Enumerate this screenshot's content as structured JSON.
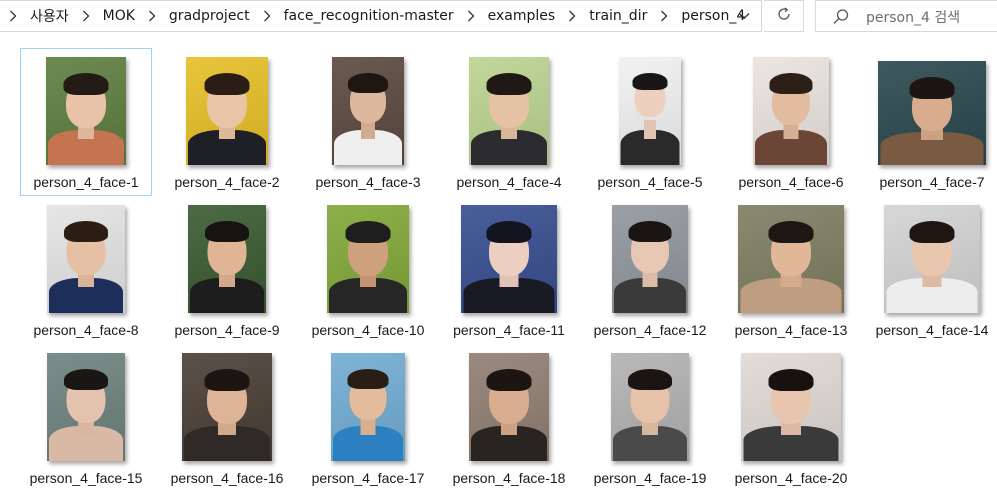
{
  "address_bar": {
    "breadcrumbs": [
      "사용자",
      "MOK",
      "gradproject",
      "face_recognition-master",
      "examples",
      "train_dir",
      "person_4"
    ]
  },
  "search": {
    "placeholder": "person_4 검색"
  },
  "files": [
    {
      "name": "person_4_face-1",
      "bg": "#6d8a52",
      "skin": "#e8c3a8",
      "hair": "#241b16",
      "cloth": "#c4744e",
      "selected": true
    },
    {
      "name": "person_4_face-2",
      "bg": "#e8c53a",
      "skin": "#e9c4a6",
      "hair": "#2a1d16",
      "cloth": "#1f1f26",
      "selected": false
    },
    {
      "name": "person_4_face-3",
      "bg": "#6a5a52",
      "skin": "#deb89c",
      "hair": "#1d1613",
      "cloth": "#efefef",
      "selected": false
    },
    {
      "name": "person_4_face-4",
      "bg": "#c2d89a",
      "skin": "#e6c2a5",
      "hair": "#201814",
      "cloth": "#2b2b30",
      "selected": false
    },
    {
      "name": "person_4_face-5",
      "bg": "#f2f2f2",
      "skin": "#ecd0bd",
      "hair": "#1a1616",
      "cloth": "#2a2a2a",
      "selected": false
    },
    {
      "name": "person_4_face-6",
      "bg": "#ece6e2",
      "skin": "#e3bb9f",
      "hair": "#2b1f18",
      "cloth": "#6b4637",
      "selected": false
    },
    {
      "name": "person_4_face-7",
      "bg": "#3e5a5e",
      "skin": "#d8ad8e",
      "hair": "#1d1512",
      "cloth": "#7a5a40",
      "selected": false
    },
    {
      "name": "person_4_face-8",
      "bg": "#e6e6e6",
      "skin": "#e5c0a4",
      "hair": "#2b1c14",
      "cloth": "#1e2e5a",
      "selected": false
    },
    {
      "name": "person_4_face-9",
      "bg": "#4c6a44",
      "skin": "#e0b596",
      "hair": "#181313",
      "cloth": "#1d1d1d",
      "selected": false
    },
    {
      "name": "person_4_face-10",
      "bg": "#8db04a",
      "skin": "#cfa07e",
      "hair": "#1e1e1e",
      "cloth": "#262626",
      "selected": false
    },
    {
      "name": "person_4_face-11",
      "bg": "#4a5f9a",
      "skin": "#eccfc0",
      "hair": "#141420",
      "cloth": "#1a1a24",
      "selected": false
    },
    {
      "name": "person_4_face-12",
      "bg": "#9aa0a6",
      "skin": "#e7c8b4",
      "hair": "#1a1412",
      "cloth": "#3a3a3a",
      "selected": false
    },
    {
      "name": "person_4_face-13",
      "bg": "#8a8a70",
      "skin": "#e1b79a",
      "hair": "#1d1613",
      "cloth": "#bf9d80",
      "selected": false
    },
    {
      "name": "person_4_face-14",
      "bg": "#d7d7d7",
      "skin": "#e8c7ae",
      "hair": "#1f1612",
      "cloth": "#ededed",
      "selected": false
    },
    {
      "name": "person_4_face-15",
      "bg": "#7b8e8a",
      "skin": "#e3c3ad",
      "hair": "#1a1613",
      "cloth": "#d9b8a6",
      "selected": false
    },
    {
      "name": "person_4_face-16",
      "bg": "#5b5148",
      "skin": "#ddb496",
      "hair": "#1c1512",
      "cloth": "#2f2a26",
      "selected": false
    },
    {
      "name": "person_4_face-17",
      "bg": "#7fb4d8",
      "skin": "#e4bc9c",
      "hair": "#2a1d15",
      "cloth": "#2c7fc0",
      "selected": false
    },
    {
      "name": "person_4_face-18",
      "bg": "#9a8a80",
      "skin": "#d8ad90",
      "hair": "#1c1512",
      "cloth": "#2a2420",
      "selected": false
    },
    {
      "name": "person_4_face-19",
      "bg": "#b9b9b9",
      "skin": "#e6c3a8",
      "hair": "#1a1412",
      "cloth": "#4a4a4a",
      "selected": false
    },
    {
      "name": "person_4_face-20",
      "bg": "#e3ddd9",
      "skin": "#e7c5ae",
      "hair": "#171210",
      "cloth": "#3a3a3a",
      "selected": false
    }
  ]
}
